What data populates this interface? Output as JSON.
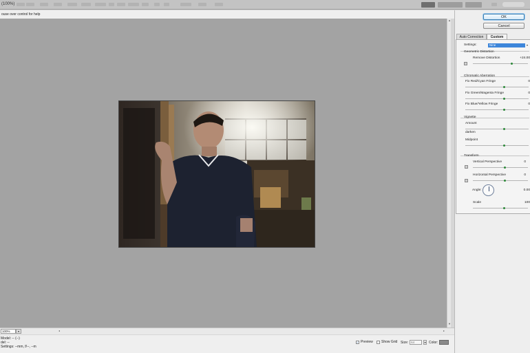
{
  "window": {
    "title": "(100%)"
  },
  "hint": "ouse over control for help",
  "buttons": {
    "ok": "OK",
    "cancel": "Cancel"
  },
  "tabs": [
    {
      "label": "Auto Correction",
      "active": false
    },
    {
      "label": "Custom",
      "active": true
    }
  ],
  "panel": {
    "settings_label": "Settings:",
    "settings_value": "Nine",
    "geometric": {
      "title": "Geometric Distortion",
      "remove_label": "Remove Distortion",
      "remove_value": "+24.00"
    },
    "chromatic": {
      "title": "Chromatic Aberration",
      "items": [
        {
          "label": "Fix Red/Cyan Fringe",
          "value": "0"
        },
        {
          "label": "Fix Green/Magenta Fringe",
          "value": "0"
        },
        {
          "label": "Fix Blue/Yellow Fringe",
          "value": "0"
        }
      ]
    },
    "vignette": {
      "title": "Vignette",
      "amount_label": "Amount",
      "darken_label": "darken",
      "midpoint_label": "Midpoint"
    },
    "transform": {
      "title": "Transform",
      "vertical_label": "Vertical Perspective",
      "vertical_value": "0",
      "horizontal_label": "Horizontal Perspective",
      "horizontal_value": "0",
      "angle_label": "Angle:",
      "angle_value": "0.00",
      "scale_label": "Scale",
      "scale_value": "100"
    }
  },
  "zoom": {
    "value": "100%"
  },
  "info": {
    "model": "Model: -- (--)",
    "lens": "del: --",
    "settings": "Settings: --mm, f/--, --m"
  },
  "options": {
    "preview_label": "Preview",
    "preview_checked": true,
    "show_grid_label": "Show Grid",
    "show_grid_checked": false,
    "size_label": "Size:",
    "size_value": "64",
    "color_label": "Color:"
  }
}
